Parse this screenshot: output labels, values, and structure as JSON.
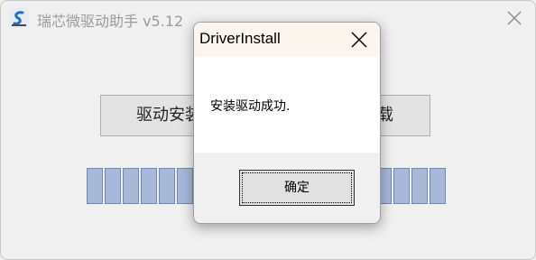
{
  "app": {
    "title": "瑞芯微驱动助手 v5.12",
    "icon": "app-logo-icon",
    "close_icon": "close-icon"
  },
  "main": {
    "install_button_label": "驱动安装",
    "uninstall_button_label": "驱动卸载",
    "progress": {
      "segments_total": 20,
      "fill_fraction": 1.0,
      "color": "#a7b8d8"
    }
  },
  "dialog": {
    "title": "DriverInstall",
    "message": "安装驱动成功.",
    "ok_label": "确定",
    "close_icon": "close-icon"
  }
}
